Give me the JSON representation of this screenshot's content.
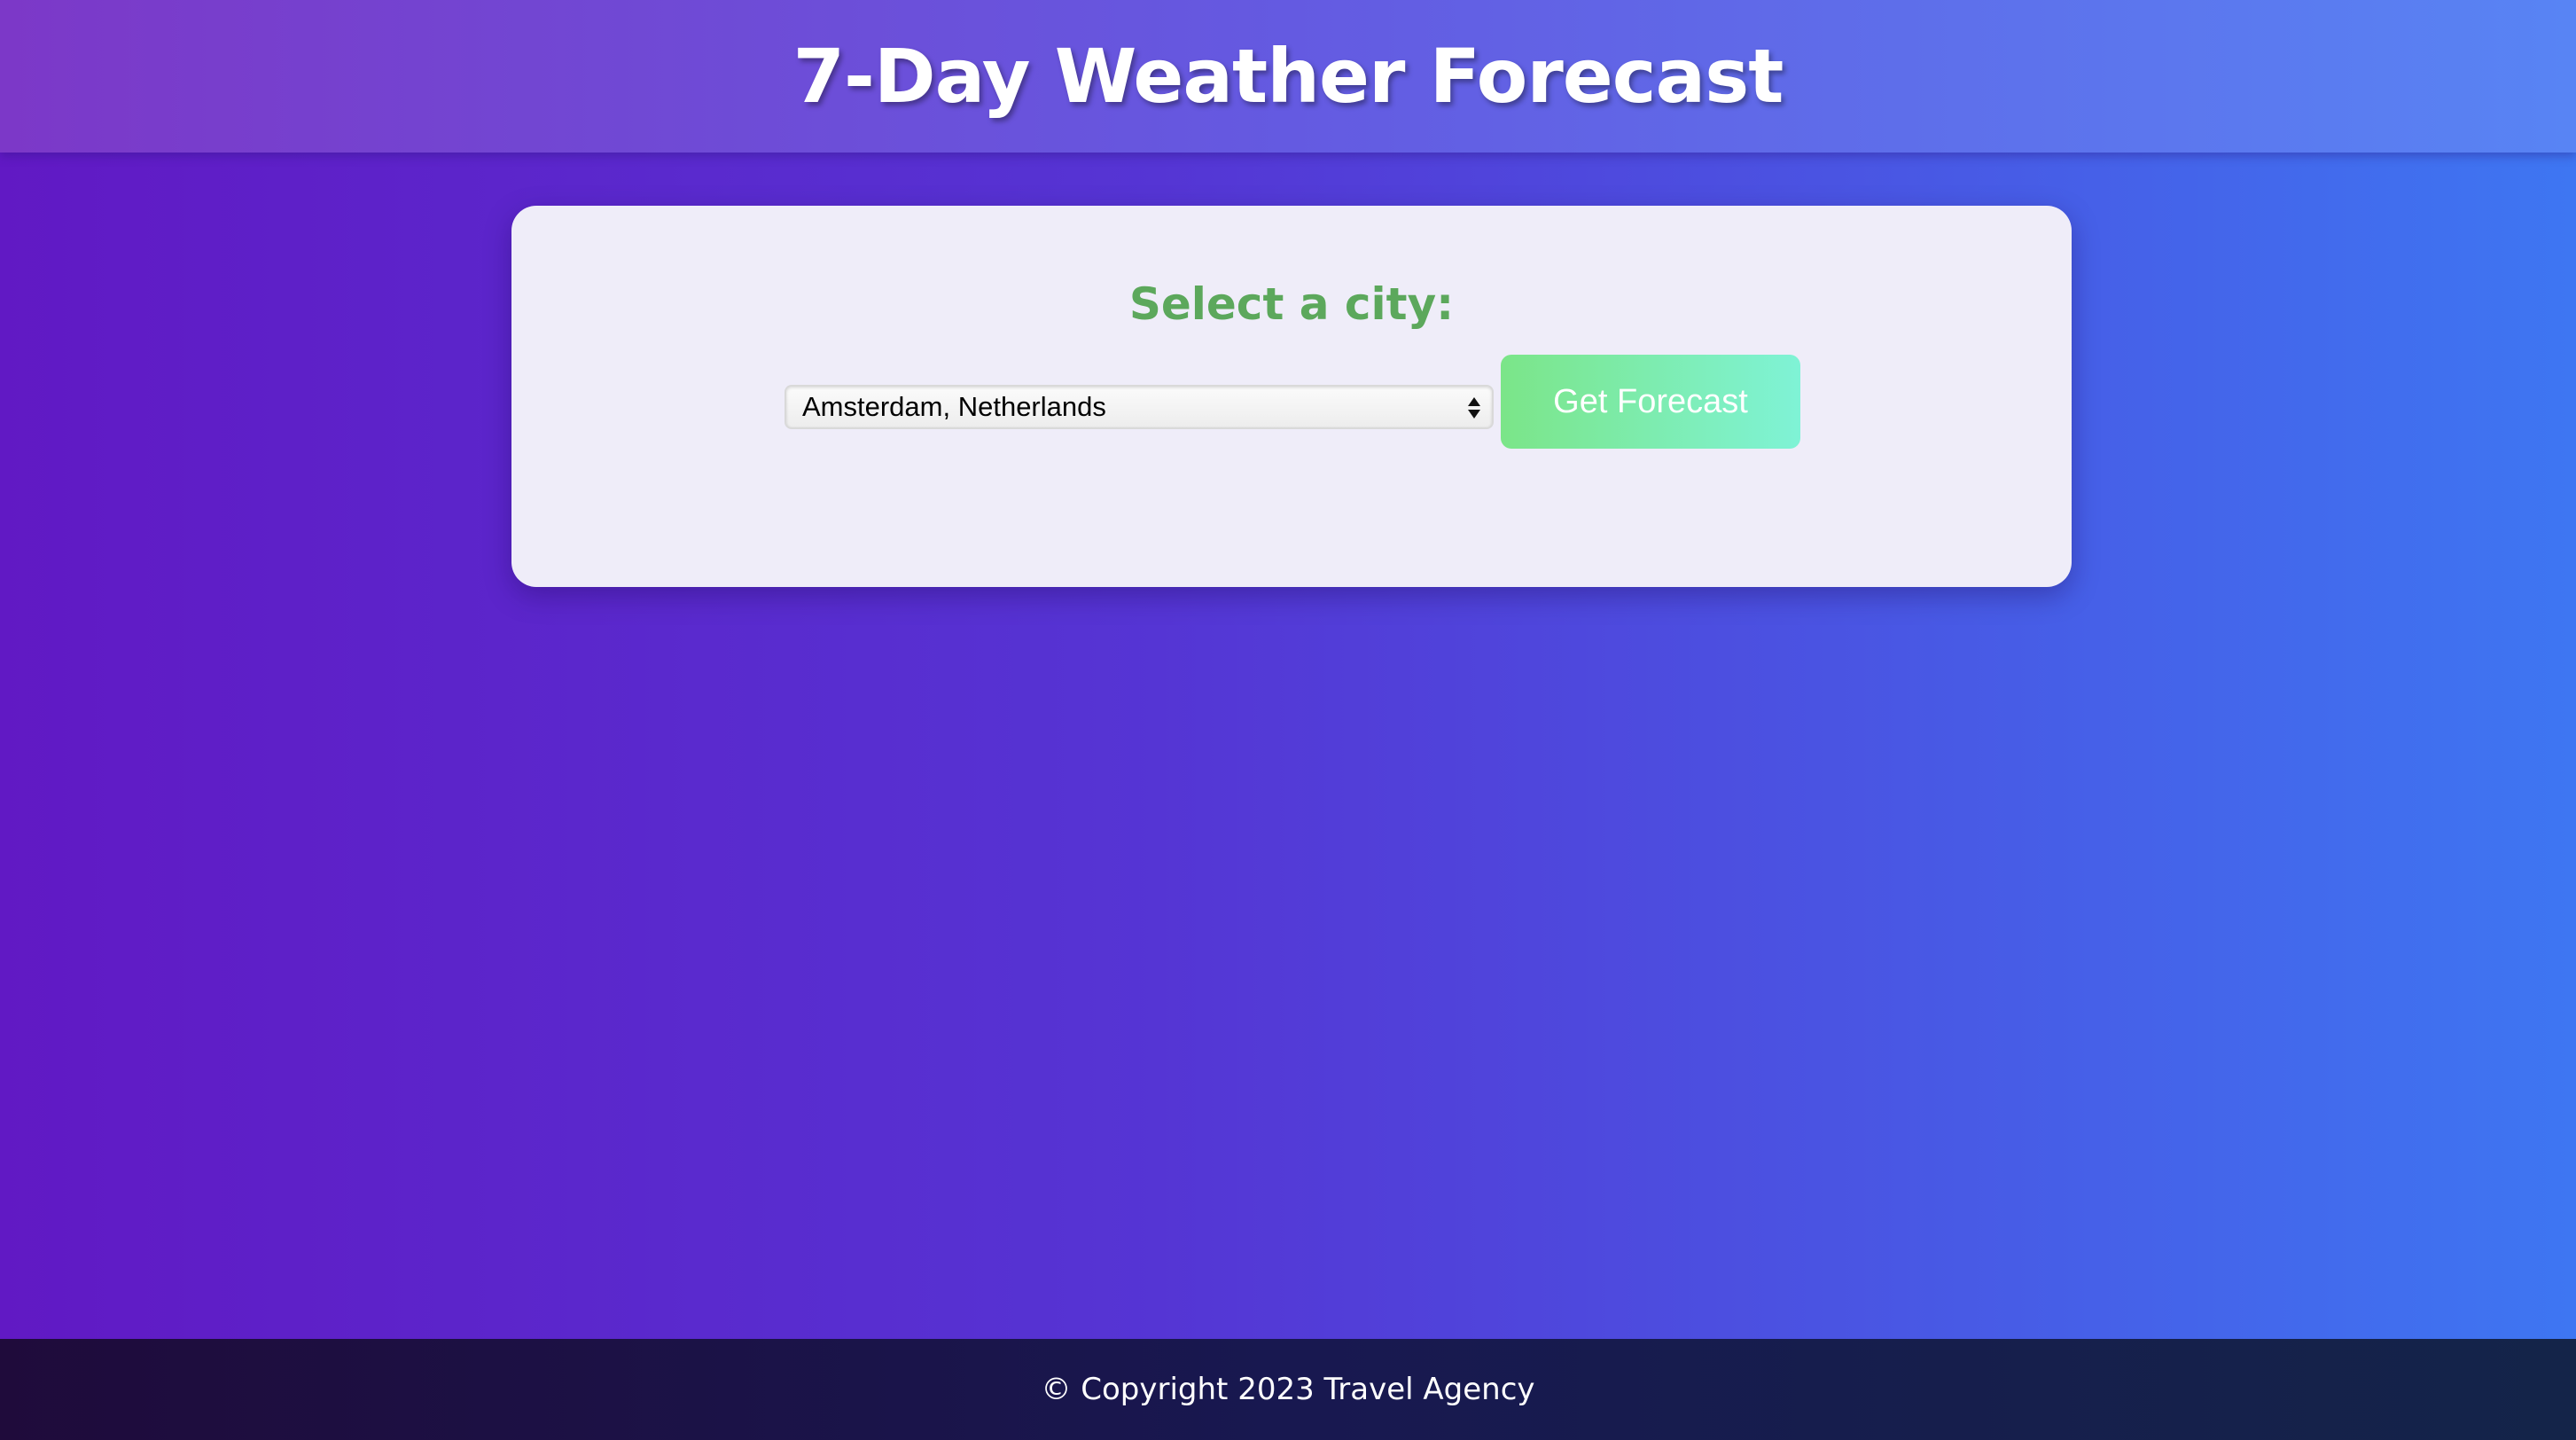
{
  "header": {
    "title": "7-Day Weather Forecast"
  },
  "card": {
    "title": "Select a city:",
    "city_select": {
      "selected_value": "Amsterdam, Netherlands"
    },
    "forecast_button_label": "Get Forecast"
  },
  "footer": {
    "copyright": "© Copyright 2023 Travel Agency"
  },
  "colors": {
    "card_title": "#5ca85c",
    "button_gradient_start": "#7be588",
    "button_gradient_end": "#7ff3d6",
    "background_start": "#6119c4",
    "background_end": "#3e76f2"
  },
  "icons": {
    "select_arrows": "up-down-arrows-icon"
  }
}
